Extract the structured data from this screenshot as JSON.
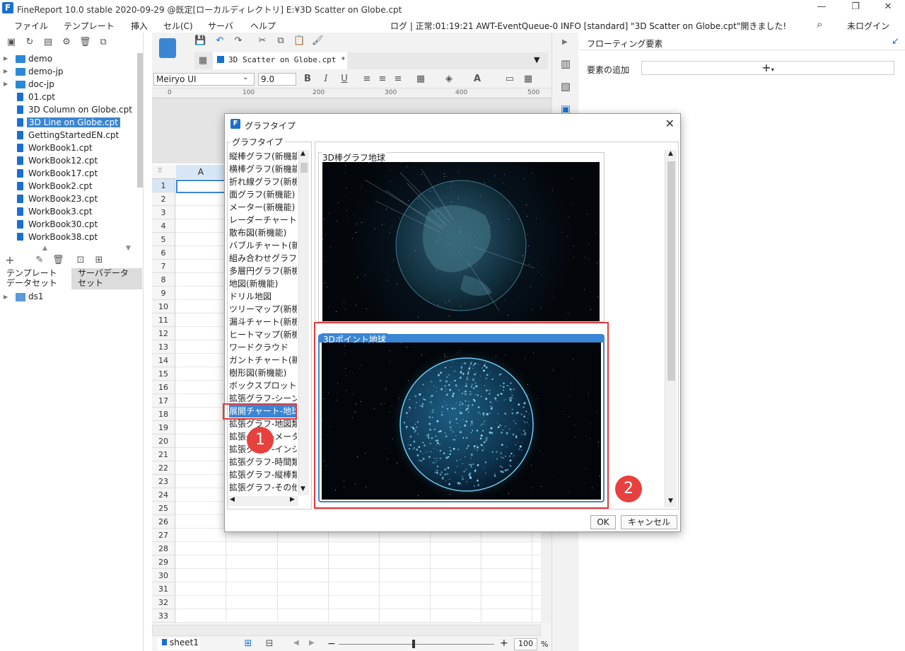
{
  "window": {
    "title": "FineReport 10.0 stable 2020-09-29 @既定[ローカルディレクトリ]   E:¥3D Scatter on Globe.cpt",
    "logo_letter": "F"
  },
  "menu": [
    "ファイル",
    "テンプレート",
    "挿入",
    "セル(C)",
    "サーバ",
    "ヘルプ"
  ],
  "status_log": "ログ | 正常:01:19:21 AWT-EventQueue-0 INFO [standard] \"3D Scatter on Globe.cpt\"開きました!",
  "login_label": "未ログイン",
  "file_tree": [
    {
      "label": "demo",
      "type": "folder"
    },
    {
      "label": "demo-jp",
      "type": "folder"
    },
    {
      "label": "doc-jp",
      "type": "folder"
    },
    {
      "label": "01.cpt",
      "type": "file"
    },
    {
      "label": "3D Column on Globe.cpt",
      "type": "file"
    },
    {
      "label": "3D Line on Globe.cpt",
      "type": "file",
      "selected": true
    },
    {
      "label": "GettingStartedEN.cpt",
      "type": "file"
    },
    {
      "label": "WorkBook1.cpt",
      "type": "file"
    },
    {
      "label": "WorkBook12.cpt",
      "type": "file"
    },
    {
      "label": "WorkBook17.cpt",
      "type": "file"
    },
    {
      "label": "WorkBook2.cpt",
      "type": "file"
    },
    {
      "label": "WorkBook23.cpt",
      "type": "file"
    },
    {
      "label": "WorkBook3.cpt",
      "type": "file"
    },
    {
      "label": "WorkBook30.cpt",
      "type": "file"
    },
    {
      "label": "WorkBook38.cpt",
      "type": "file"
    }
  ],
  "dataset_tabs": [
    "テンプレート\nデータセット",
    "サーバデータ\nセット"
  ],
  "dataset_item": "ds1",
  "tab_label": "3D Scatter on Globe.cpt *",
  "font": {
    "name": "Meiryo UI",
    "size": "9.0"
  },
  "ruler_ticks": [
    "0",
    "100",
    "200",
    "300",
    "400",
    "500"
  ],
  "column_header": "A",
  "row_numbers": [
    "1",
    "2",
    "3",
    "4",
    "5",
    "6",
    "7",
    "8",
    "9",
    "10",
    "11",
    "12",
    "13",
    "14",
    "15",
    "16",
    "17",
    "18",
    "19",
    "20",
    "21",
    "22",
    "23",
    "24",
    "25",
    "26",
    "27",
    "28",
    "29",
    "30",
    "31",
    "32",
    "33"
  ],
  "sheet_tab": "sheet1",
  "zoom": "100",
  "zoom_unit": "%",
  "right_panel": {
    "title": "フローティング要素",
    "add_label": "要素の追加"
  },
  "dialog": {
    "title": "グラフタイプ",
    "group_label": "グラフタイプ",
    "types": [
      "縦棒グラフ(新機能)",
      "横棒グラフ(新機能)",
      "折れ線グラフ(新機能)",
      "面グラフ(新機能)",
      "メーター(新機能)",
      "レーダーチャート",
      "散布図(新機能)",
      "バブルチャート(新機能)",
      "組み合わせグラフ",
      "多層円グラフ(新機能)",
      "地図(新機能)",
      "ドリル地図",
      "ツリーマップ(新機能)",
      "漏斗チャート(新機能)",
      "ヒートマップ(新機能)",
      "ワードクラウド",
      "ガントチャート(新機能)",
      "樹形図(新機能)",
      "ボックスプロット",
      "拡張グラフ-シーン",
      "展開チャート-地球",
      "拡張グラフ-地図類",
      "拡張グラフ-メーター",
      "拡張グラフ-インジ",
      "拡張グラフ-時間類",
      "拡張グラフ-縦棒類",
      "拡張グラフ-その他"
    ],
    "selected_index": 20,
    "previews": [
      "3D棒グラフ地球",
      "3Dポイント地球"
    ],
    "ok_label": "OK",
    "cancel_label": "キャンセル"
  },
  "badges": [
    "1",
    "2"
  ],
  "colors": {
    "accent": "#3a86d4",
    "highlight": "#e23b3b",
    "brand": "#1a6fd0"
  }
}
